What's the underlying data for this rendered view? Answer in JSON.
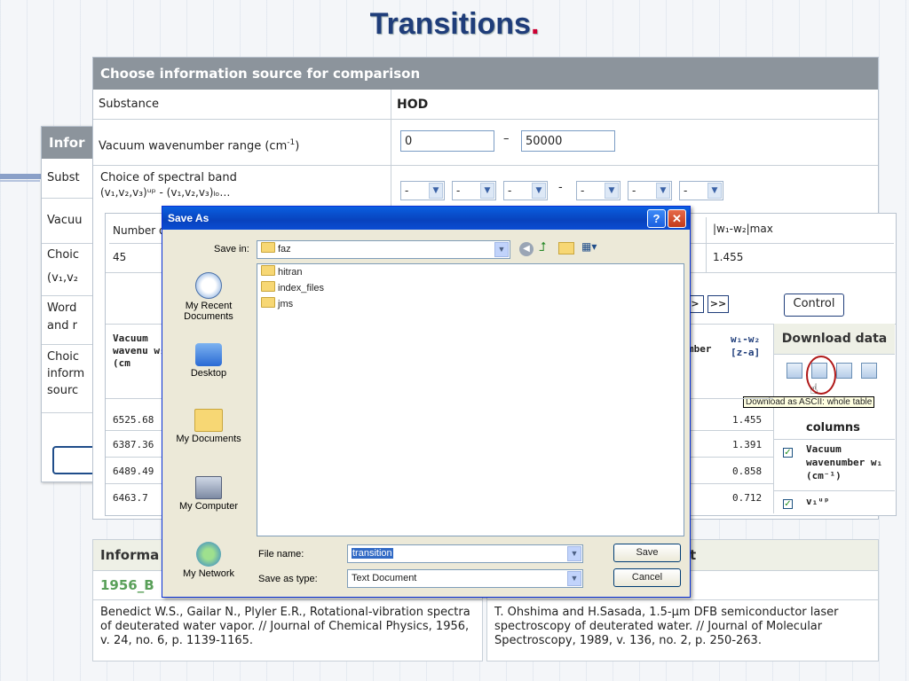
{
  "slide": {
    "title": "Transitions",
    "title_dot": "."
  },
  "back_window": {
    "header": "Infor",
    "rows": [
      "Subst",
      "Vacuu",
      "Choic",
      "(v₁,v₂",
      "Word",
      "and r",
      "Choic",
      "inform",
      "sourc"
    ]
  },
  "main": {
    "header": "Choose information source for comparison",
    "substance_label": "Substance",
    "substance_value": "HOD",
    "range_label": "Vacuum wavenumber range (cm",
    "range_unit_sup": "-1",
    "range_close": ")",
    "range_from": "0",
    "range_dash": "–",
    "range_to": "50000",
    "band_label": "Choice of spectral band",
    "band_formula": "(v₁,v₂,v₃)ᵘᵖ - (v₁,v₂,v₃)ₗₒ…",
    "band_selects": [
      "-",
      "-",
      "-",
      "-",
      "-",
      "-"
    ],
    "band_sep": "-"
  },
  "inner": {
    "number_label": "Number o",
    "number_value": "45",
    "w_max_label": "|w₁-w₂|max",
    "w_max_value": "1.455",
    "nav_next": ">",
    "nav_last": ">>",
    "control_label": "Control",
    "col_vacuum": "Vacuum wavenu w₁ (cm",
    "col_number_partial": "mber",
    "col_w1w2": "w₁-w₂ [z-a]",
    "download_header": "Download data",
    "tooltip": "Download as ASCII: whole table",
    "chosen_columns": "columns",
    "rows": [
      {
        "w1": "6525.68",
        "diff": "1.455"
      },
      {
        "w1": "6387.36",
        "diff": "1.391"
      },
      {
        "w1": "6489.49",
        "diff": "0.858"
      },
      {
        "w1": "6463.7",
        "diff": "0.712"
      }
    ],
    "column_options": [
      {
        "label": "Vacuum wavenumber w₁ (cm⁻¹)",
        "checked": true
      },
      {
        "label": "v₁ᵘᵖ",
        "checked": true
      }
    ]
  },
  "bottom": {
    "left_head": "Informa",
    "left_link": "1956_B",
    "left_ref": "Benedict W.S., Gailar N., Plyler E.R., Rotational-vibration spectra of deuterated water vapor. // Journal of Chemical Physics, 1956, v. 24, no. 6, p. 1139-1165.",
    "right_head": "t",
    "right_ref": "T. Ohshima and H.Sasada, 1.5-µm DFB semiconductor laser spectroscopy of deuterated water. // Journal of Molecular Spectroscopy, 1989, v. 136, no. 2, p. 250-263."
  },
  "dialog": {
    "title": "Save As",
    "help_btn": "?",
    "close_btn": "✕",
    "save_in_label": "Save in:",
    "save_in_value": "faz",
    "places": [
      "My Recent Documents",
      "Desktop",
      "My Documents",
      "My Computer",
      "My Network"
    ],
    "files": [
      "hitran",
      "index_files",
      "jms"
    ],
    "file_name_label": "File name:",
    "file_name_value": "transition",
    "save_type_label": "Save as type:",
    "save_type_value": "Text Document",
    "save_button": "Save",
    "cancel_button": "Cancel"
  }
}
